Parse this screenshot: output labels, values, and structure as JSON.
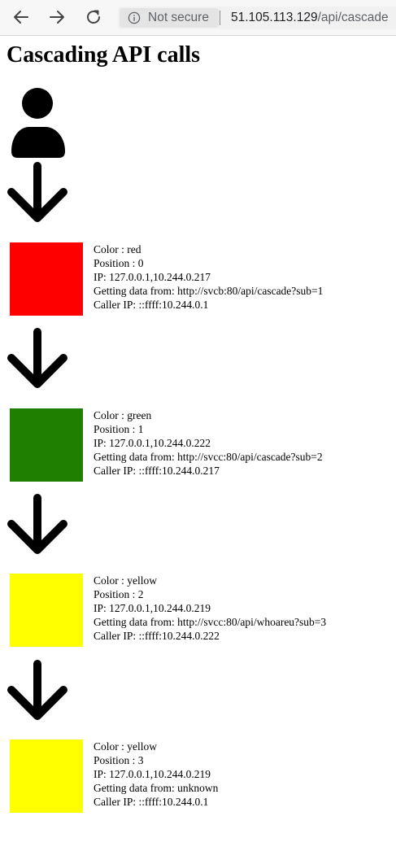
{
  "browser": {
    "security_label": "Not secure",
    "url_host": "51.105.113.129",
    "url_path": "/api/cascade"
  },
  "page": {
    "title": "Cascading API calls"
  },
  "cascade": [
    {
      "color_name": "red",
      "swatch_color": "#ff0000",
      "color_line": "Color : red",
      "position_line": "Position : 0",
      "ip_line": "IP: 127.0.0.1,10.244.0.217",
      "source_line": "Getting data from: http://svcb:80/api/cascade?sub=1",
      "caller_line": "Caller IP: ::ffff:10.244.0.1"
    },
    {
      "color_name": "green",
      "swatch_color": "#1f7f00",
      "color_line": "Color : green",
      "position_line": "Position : 1",
      "ip_line": "IP: 127.0.0.1,10.244.0.222",
      "source_line": "Getting data from: http://svcc:80/api/cascade?sub=2",
      "caller_line": "Caller IP: ::ffff:10.244.0.217"
    },
    {
      "color_name": "yellow",
      "swatch_color": "#ffff00",
      "color_line": "Color : yellow",
      "position_line": "Position : 2",
      "ip_line": "IP: 127.0.0.1,10.244.0.219",
      "source_line": "Getting data from: http://svcc:80/api/whoareu?sub=3",
      "caller_line": "Caller IP: ::ffff:10.244.0.222"
    },
    {
      "color_name": "yellow",
      "swatch_color": "#ffff00",
      "color_line": "Color : yellow",
      "position_line": "Position : 3",
      "ip_line": "IP: 127.0.0.1,10.244.0.219",
      "source_line": "Getting data from: unknown",
      "caller_line": "Caller IP: ::ffff:10.244.0.1"
    }
  ],
  "icons": {
    "back": "arrow-left-icon",
    "forward": "arrow-right-icon",
    "reload": "reload-icon",
    "info": "info-icon",
    "user": "user-icon",
    "flow": "arrow-down-icon"
  }
}
